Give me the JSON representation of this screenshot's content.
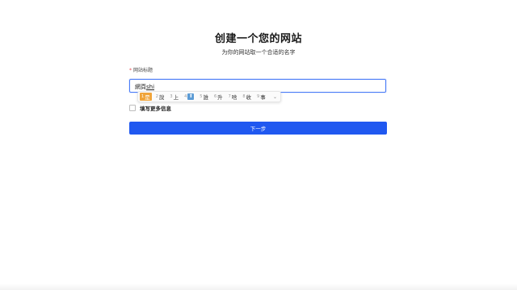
{
  "header": {
    "title": "创建一个您的网站",
    "subtitle": "为你的网站取一个合适的名字"
  },
  "form": {
    "site_title_label": "网站标题",
    "required_mark": "*",
    "input_committed": "網頁",
    "input_composing": "shi",
    "more_info_label": "填写更多信息",
    "next_button": "下一步"
  },
  "ime": {
    "candidates": [
      {
        "num": "1",
        "text": "是",
        "selected": true
      },
      {
        "num": "2",
        "text": "說"
      },
      {
        "num": "3",
        "text": "上"
      },
      {
        "num": "4",
        "text": "⬆",
        "emoji": true
      },
      {
        "num": "5",
        "text": "誰"
      },
      {
        "num": "6",
        "text": "升"
      },
      {
        "num": "7",
        "text": "啥"
      },
      {
        "num": "8",
        "text": "收"
      },
      {
        "num": "9",
        "text": "事"
      }
    ],
    "more_symbol": "⌄"
  },
  "colors": {
    "primary": "#2058f0",
    "focus_border": "#4a7cf7",
    "ime_selected": "#f0a43a",
    "required": "#e5484d"
  }
}
